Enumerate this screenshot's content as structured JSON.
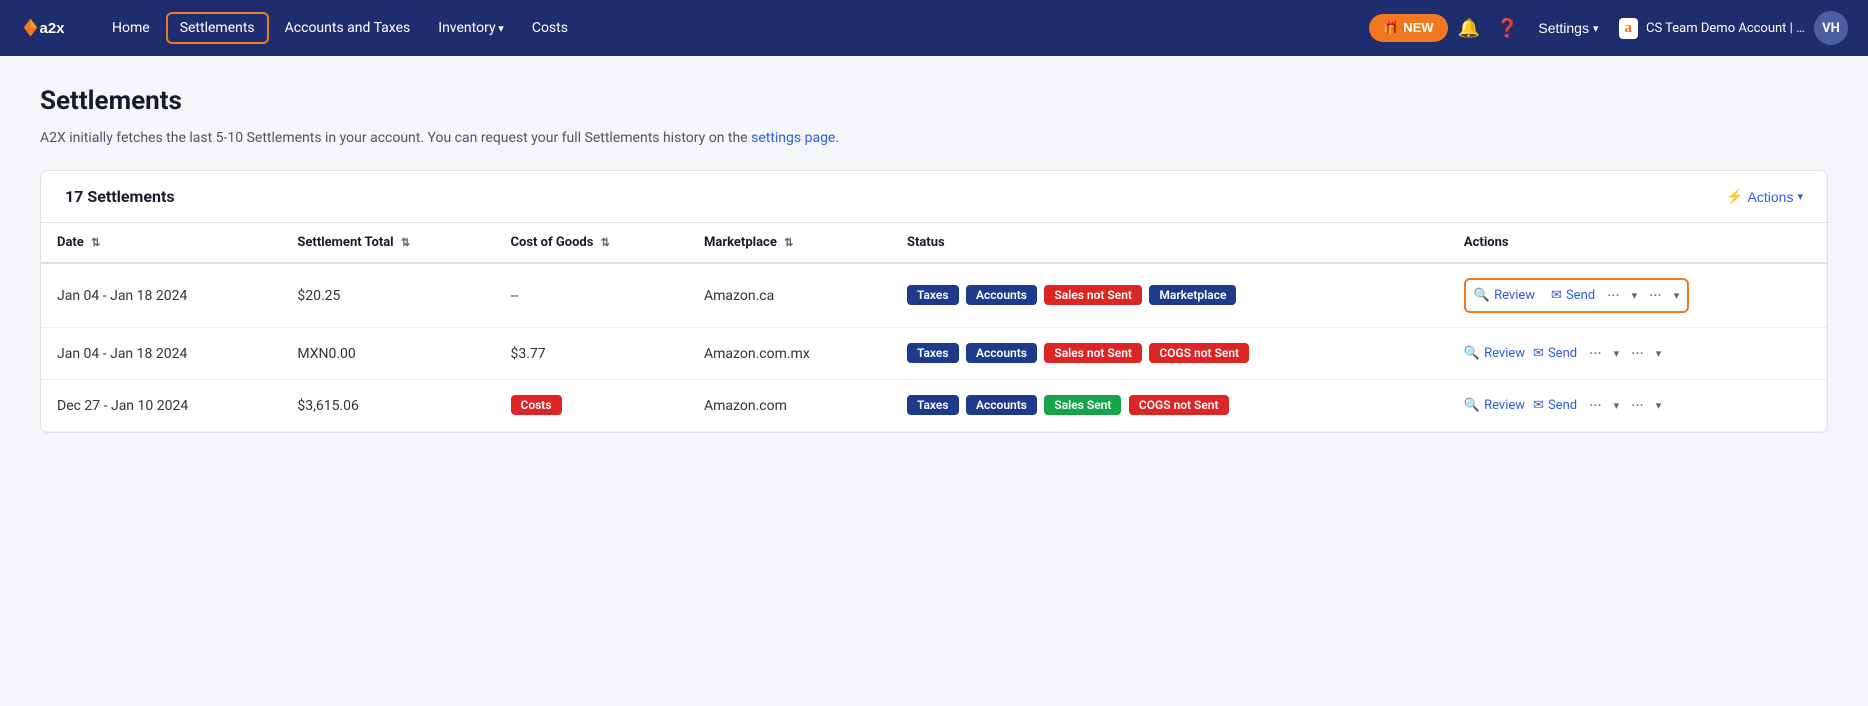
{
  "nav": {
    "logo_text": "a2x",
    "links": [
      {
        "label": "Home",
        "id": "home",
        "highlighted": false,
        "has_arrow": false
      },
      {
        "label": "Settlements",
        "id": "settlements",
        "highlighted": true,
        "has_arrow": false
      },
      {
        "label": "Accounts and Taxes",
        "id": "accounts-taxes",
        "highlighted": false,
        "has_arrow": false
      },
      {
        "label": "Inventory",
        "id": "inventory",
        "highlighted": false,
        "has_arrow": true
      },
      {
        "label": "Costs",
        "id": "costs",
        "highlighted": false,
        "has_arrow": false
      }
    ],
    "new_btn_label": "🎁 NEW",
    "settings_label": "Settings",
    "account_text": "CS Team Demo Account | QB US | Amaz...",
    "avatar_initials": "VH"
  },
  "page": {
    "title": "Settlements",
    "subtitle_prefix": "A2X initially fetches the last 5-10 Settlements in your account. You can request your full Settlements history on the ",
    "subtitle_link_text": "settings page",
    "subtitle_suffix": "."
  },
  "panel": {
    "title": "17 Settlements",
    "actions_label": "Actions"
  },
  "table": {
    "columns": [
      {
        "id": "date",
        "label": "Date",
        "sortable": true
      },
      {
        "id": "settlement_total",
        "label": "Settlement Total",
        "sortable": true
      },
      {
        "id": "cost_of_goods",
        "label": "Cost of Goods",
        "sortable": true
      },
      {
        "id": "marketplace",
        "label": "Marketplace",
        "sortable": true
      },
      {
        "id": "status",
        "label": "Status",
        "sortable": false
      },
      {
        "id": "actions",
        "label": "Actions",
        "sortable": false
      }
    ],
    "rows": [
      {
        "id": "row1",
        "date": "Jan 04 - Jan 18 2024",
        "settlement_total": "$20.25",
        "cost_of_goods": "--",
        "marketplace": "Amazon.ca",
        "badges": [
          {
            "label": "Taxes",
            "type": "taxes"
          },
          {
            "label": "Accounts",
            "type": "accounts"
          },
          {
            "label": "Sales not Sent",
            "type": "sales-not-sent"
          },
          {
            "label": "Marketplace",
            "type": "marketplace"
          }
        ],
        "highlighted_actions": true
      },
      {
        "id": "row2",
        "date": "Jan 04 - Jan 18 2024",
        "settlement_total": "MXN0.00",
        "cost_of_goods": "$3.77",
        "marketplace": "Amazon.com.mx",
        "badges": [
          {
            "label": "Taxes",
            "type": "taxes"
          },
          {
            "label": "Accounts",
            "type": "accounts"
          },
          {
            "label": "Sales not Sent",
            "type": "sales-not-sent"
          },
          {
            "label": "COGS not Sent",
            "type": "cogs-not-sent"
          }
        ],
        "highlighted_actions": false
      },
      {
        "id": "row3",
        "date": "Dec 27 - Jan 10 2024",
        "settlement_total": "$3,615.06",
        "cost_of_goods_badge": "Costs",
        "marketplace": "Amazon.com",
        "badges": [
          {
            "label": "Taxes",
            "type": "taxes"
          },
          {
            "label": "Accounts",
            "type": "accounts"
          },
          {
            "label": "Sales Sent",
            "type": "sales-sent"
          },
          {
            "label": "COGS not Sent",
            "type": "cogs-not-sent"
          }
        ],
        "highlighted_actions": false
      }
    ],
    "review_label": "Review",
    "send_label": "Send"
  }
}
